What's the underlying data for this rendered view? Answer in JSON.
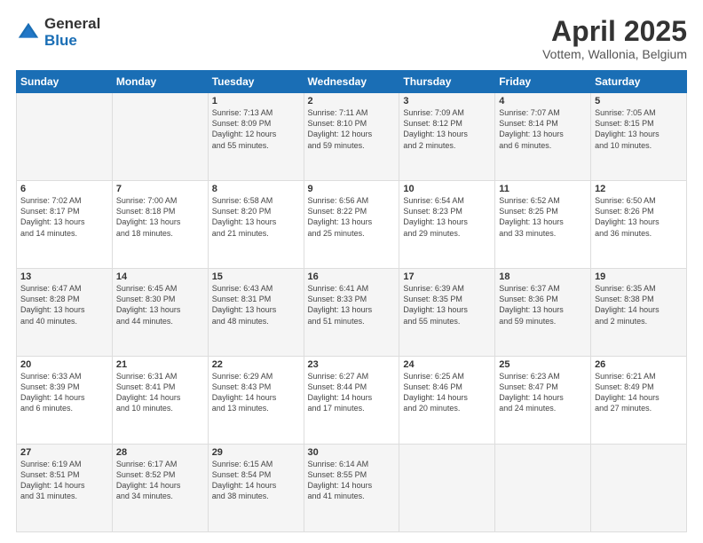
{
  "logo": {
    "general": "General",
    "blue": "Blue"
  },
  "title": "April 2025",
  "location": "Vottem, Wallonia, Belgium",
  "weekdays": [
    "Sunday",
    "Monday",
    "Tuesday",
    "Wednesday",
    "Thursday",
    "Friday",
    "Saturday"
  ],
  "weeks": [
    [
      {
        "day": "",
        "content": ""
      },
      {
        "day": "",
        "content": ""
      },
      {
        "day": "1",
        "content": "Sunrise: 7:13 AM\nSunset: 8:09 PM\nDaylight: 12 hours\nand 55 minutes."
      },
      {
        "day": "2",
        "content": "Sunrise: 7:11 AM\nSunset: 8:10 PM\nDaylight: 12 hours\nand 59 minutes."
      },
      {
        "day": "3",
        "content": "Sunrise: 7:09 AM\nSunset: 8:12 PM\nDaylight: 13 hours\nand 2 minutes."
      },
      {
        "day": "4",
        "content": "Sunrise: 7:07 AM\nSunset: 8:14 PM\nDaylight: 13 hours\nand 6 minutes."
      },
      {
        "day": "5",
        "content": "Sunrise: 7:05 AM\nSunset: 8:15 PM\nDaylight: 13 hours\nand 10 minutes."
      }
    ],
    [
      {
        "day": "6",
        "content": "Sunrise: 7:02 AM\nSunset: 8:17 PM\nDaylight: 13 hours\nand 14 minutes."
      },
      {
        "day": "7",
        "content": "Sunrise: 7:00 AM\nSunset: 8:18 PM\nDaylight: 13 hours\nand 18 minutes."
      },
      {
        "day": "8",
        "content": "Sunrise: 6:58 AM\nSunset: 8:20 PM\nDaylight: 13 hours\nand 21 minutes."
      },
      {
        "day": "9",
        "content": "Sunrise: 6:56 AM\nSunset: 8:22 PM\nDaylight: 13 hours\nand 25 minutes."
      },
      {
        "day": "10",
        "content": "Sunrise: 6:54 AM\nSunset: 8:23 PM\nDaylight: 13 hours\nand 29 minutes."
      },
      {
        "day": "11",
        "content": "Sunrise: 6:52 AM\nSunset: 8:25 PM\nDaylight: 13 hours\nand 33 minutes."
      },
      {
        "day": "12",
        "content": "Sunrise: 6:50 AM\nSunset: 8:26 PM\nDaylight: 13 hours\nand 36 minutes."
      }
    ],
    [
      {
        "day": "13",
        "content": "Sunrise: 6:47 AM\nSunset: 8:28 PM\nDaylight: 13 hours\nand 40 minutes."
      },
      {
        "day": "14",
        "content": "Sunrise: 6:45 AM\nSunset: 8:30 PM\nDaylight: 13 hours\nand 44 minutes."
      },
      {
        "day": "15",
        "content": "Sunrise: 6:43 AM\nSunset: 8:31 PM\nDaylight: 13 hours\nand 48 minutes."
      },
      {
        "day": "16",
        "content": "Sunrise: 6:41 AM\nSunset: 8:33 PM\nDaylight: 13 hours\nand 51 minutes."
      },
      {
        "day": "17",
        "content": "Sunrise: 6:39 AM\nSunset: 8:35 PM\nDaylight: 13 hours\nand 55 minutes."
      },
      {
        "day": "18",
        "content": "Sunrise: 6:37 AM\nSunset: 8:36 PM\nDaylight: 13 hours\nand 59 minutes."
      },
      {
        "day": "19",
        "content": "Sunrise: 6:35 AM\nSunset: 8:38 PM\nDaylight: 14 hours\nand 2 minutes."
      }
    ],
    [
      {
        "day": "20",
        "content": "Sunrise: 6:33 AM\nSunset: 8:39 PM\nDaylight: 14 hours\nand 6 minutes."
      },
      {
        "day": "21",
        "content": "Sunrise: 6:31 AM\nSunset: 8:41 PM\nDaylight: 14 hours\nand 10 minutes."
      },
      {
        "day": "22",
        "content": "Sunrise: 6:29 AM\nSunset: 8:43 PM\nDaylight: 14 hours\nand 13 minutes."
      },
      {
        "day": "23",
        "content": "Sunrise: 6:27 AM\nSunset: 8:44 PM\nDaylight: 14 hours\nand 17 minutes."
      },
      {
        "day": "24",
        "content": "Sunrise: 6:25 AM\nSunset: 8:46 PM\nDaylight: 14 hours\nand 20 minutes."
      },
      {
        "day": "25",
        "content": "Sunrise: 6:23 AM\nSunset: 8:47 PM\nDaylight: 14 hours\nand 24 minutes."
      },
      {
        "day": "26",
        "content": "Sunrise: 6:21 AM\nSunset: 8:49 PM\nDaylight: 14 hours\nand 27 minutes."
      }
    ],
    [
      {
        "day": "27",
        "content": "Sunrise: 6:19 AM\nSunset: 8:51 PM\nDaylight: 14 hours\nand 31 minutes."
      },
      {
        "day": "28",
        "content": "Sunrise: 6:17 AM\nSunset: 8:52 PM\nDaylight: 14 hours\nand 34 minutes."
      },
      {
        "day": "29",
        "content": "Sunrise: 6:15 AM\nSunset: 8:54 PM\nDaylight: 14 hours\nand 38 minutes."
      },
      {
        "day": "30",
        "content": "Sunrise: 6:14 AM\nSunset: 8:55 PM\nDaylight: 14 hours\nand 41 minutes."
      },
      {
        "day": "",
        "content": ""
      },
      {
        "day": "",
        "content": ""
      },
      {
        "day": "",
        "content": ""
      }
    ]
  ]
}
